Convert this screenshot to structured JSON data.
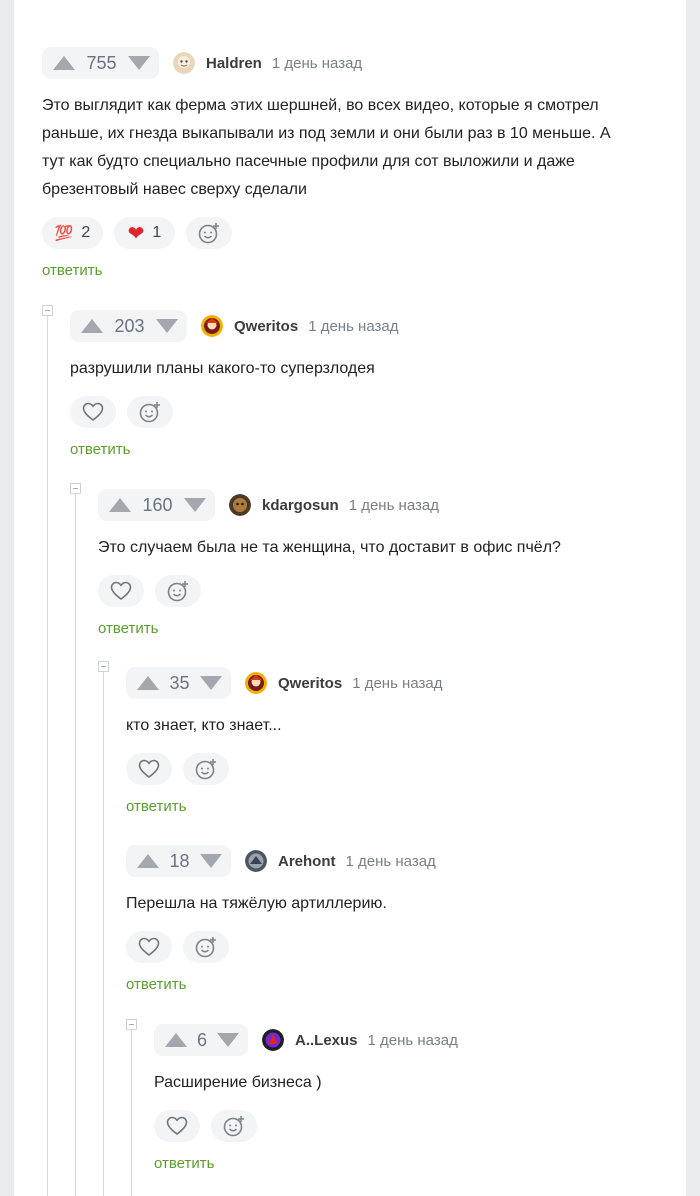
{
  "comments": [
    {
      "rating": "755",
      "username": "Haldren",
      "time": "1 день назад",
      "text": "Это выглядит как ферма этих шершней, во всех видео, которые я смотрел\nраньше, их гнезда выкапывали из под земли и они были раз в 10 меньше. А\nтут как будто специально пасечные профили для сот выложили и даже\nбрезентовый навес сверху сделали",
      "reactions": [
        {
          "icon": "hundred-points-emoji",
          "glyph": "💯",
          "count": "2"
        },
        {
          "icon": "red-heart-emoji",
          "glyph": "❤",
          "count": "1"
        }
      ],
      "reply_label": "ответить"
    },
    {
      "rating": "203",
      "username": "Qweritos",
      "time": "1 день назад",
      "text": "разрушили планы какого-то суперзлодея",
      "reply_label": "ответить"
    },
    {
      "rating": "160",
      "username": "kdargosun",
      "time": "1 день назад",
      "text": "Это случаем была не та женщина, что доставит в офис пчёл?",
      "reply_label": "ответить"
    },
    {
      "rating": "35",
      "username": "Qweritos",
      "time": "1 день назад",
      "text": "кто знает, кто знает...",
      "reply_label": "ответить"
    },
    {
      "rating": "18",
      "username": "Arehont",
      "time": "1 день назад",
      "text": "Перешла на тяжёлую артиллерию.",
      "reply_label": "ответить"
    },
    {
      "rating": "6",
      "username": "A..Lexus",
      "time": "1 день назад",
      "text": "Расширение бизнеса )",
      "reply_label": "ответить"
    }
  ],
  "colors": {
    "accent_reply": "#5a9e2e",
    "vote_bg": "#f3f4f6",
    "thread_line": "#d6d8db"
  }
}
